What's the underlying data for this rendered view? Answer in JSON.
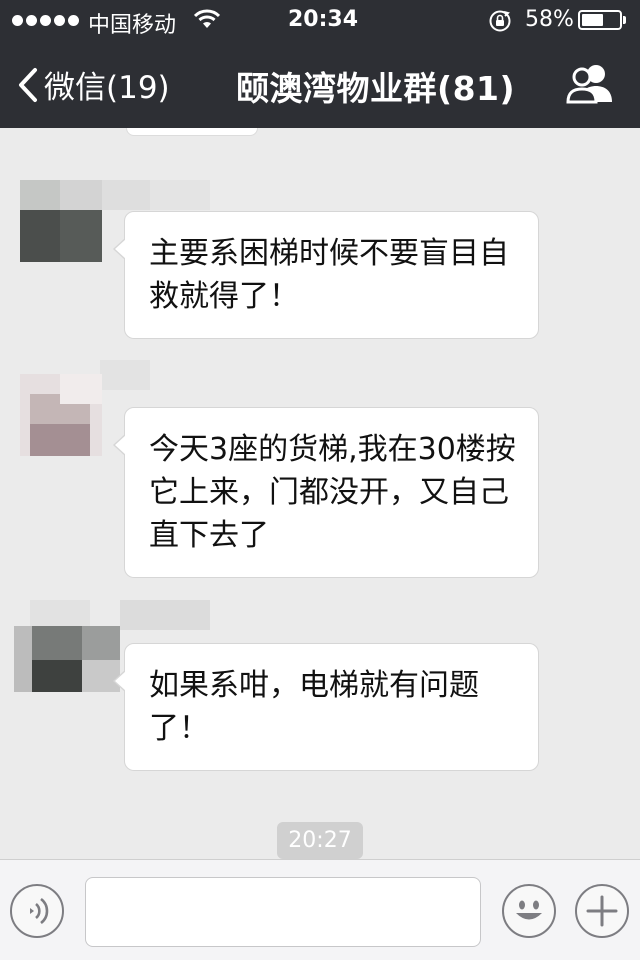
{
  "status_bar": {
    "carrier": "中国移动",
    "time": "20:34",
    "battery_percent": "58%",
    "battery_level": 0.58,
    "signal_bars": 5,
    "icons": [
      "wifi-icon",
      "rotation-lock-icon",
      "battery-icon"
    ]
  },
  "nav": {
    "back_label": "微信(19)",
    "title": "颐澳湾物业群(81)",
    "right_icon": "group-members-icon"
  },
  "messages": [
    {
      "text": "主要系困梯时候不要盲目自救就得了！"
    },
    {
      "text": "今天3座的货梯,我在30楼按它上来，门都没开，又自己直下去了"
    },
    {
      "text": "如果系咁，电梯就有问题了！"
    }
  ],
  "timestamp": "20:27",
  "input_bar": {
    "placeholder": "",
    "icons": [
      "voice-icon",
      "emoji-icon",
      "plus-icon"
    ]
  },
  "colors": {
    "nav_background": "#2d2f34",
    "chat_background": "#ebebeb",
    "bubble_background": "#ffffff"
  }
}
